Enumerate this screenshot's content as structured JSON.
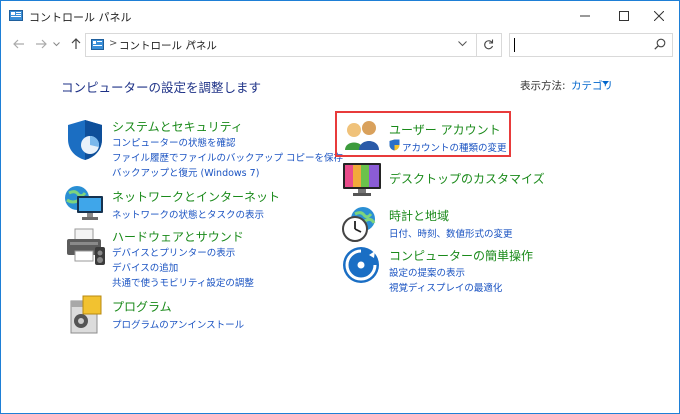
{
  "window": {
    "title": "コントロール パネル",
    "buttons": {
      "minimize": "minimize",
      "maximize": "maximize",
      "close": "close"
    }
  },
  "address": {
    "breadcrumb": [
      "コントロール パネル"
    ],
    "search_value": ""
  },
  "content": {
    "heading": "コンピューターの設定を調整します",
    "view_by_label": "表示方法:",
    "view_by_value": "カテゴリ"
  },
  "categories_left": [
    {
      "title": "システムとセキュリティ",
      "icon": "shield-icon",
      "links": [
        "コンピューターの状態を確認",
        "ファイル履歴でファイルのバックアップ コピーを保存",
        "バックアップと復元 (Windows 7)"
      ]
    },
    {
      "title": "ネットワークとインターネット",
      "icon": "network-globe-icon",
      "links": [
        "ネットワークの状態とタスクの表示"
      ]
    },
    {
      "title": "ハードウェアとサウンド",
      "icon": "printer-icon",
      "links": [
        "デバイスとプリンターの表示",
        "デバイスの追加",
        "共通で使うモビリティ設定の調整"
      ]
    },
    {
      "title": "プログラム",
      "icon": "programs-icon",
      "links": [
        "プログラムのアンインストール"
      ]
    }
  ],
  "categories_right": [
    {
      "title": "ユーザー アカウント",
      "icon": "users-icon",
      "links": [
        "アカウントの種類の変更"
      ]
    },
    {
      "title": "デスクトップのカスタマイズ",
      "icon": "monitor-icon",
      "links": []
    },
    {
      "title": "時計と地域",
      "icon": "clock-globe-icon",
      "links": [
        "日付、時刻、数値形式の変更"
      ]
    },
    {
      "title": "コンピューターの簡単操作",
      "icon": "ease-of-access-icon",
      "links": [
        "設定の提案の表示",
        "視覚ディスプレイの最適化"
      ]
    }
  ],
  "colors": {
    "category_title": "#1a8a1a",
    "link": "#1a53c2",
    "heading": "#1e3287",
    "highlight_box": "#e83b3b",
    "window_border": "#1e7fd6"
  }
}
